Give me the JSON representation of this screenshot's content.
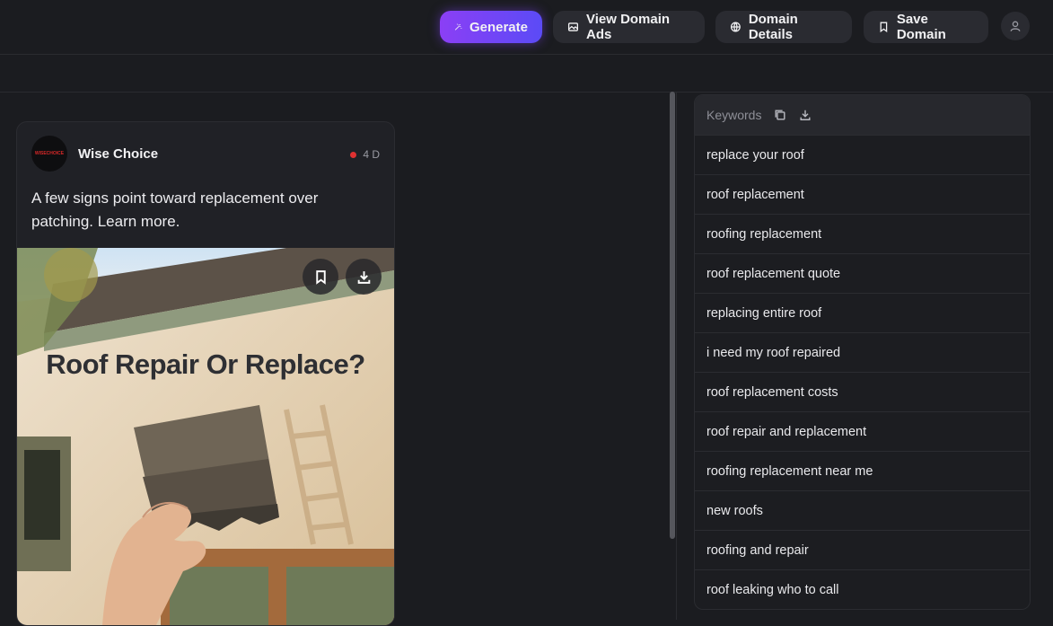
{
  "toolbar": {
    "generate_label": "Generate",
    "view_ads_label": "View Domain Ads",
    "details_label": "Domain Details",
    "save_label": "Save Domain"
  },
  "ad": {
    "brand": "Wise Choice",
    "logo_text": "WISECHOICE",
    "age": "4 D",
    "copy": "A few signs point toward replacement over patching. Learn more.",
    "creative_headline": "Roof Repair Or Replace?"
  },
  "keywords": {
    "header": "Keywords",
    "items": [
      "replace your roof",
      "roof replacement",
      "roofing replacement",
      "roof replacement quote",
      "replacing entire roof",
      "i need my roof repaired",
      "roof replacement costs",
      "roof repair and replacement",
      "roofing replacement near me",
      "new roofs",
      "roofing and repair",
      "roof leaking who to call"
    ]
  },
  "colors": {
    "background": "#1b1c20",
    "accent_start": "#8b3ff5",
    "accent_end": "#5b4bf6",
    "status_dot": "#e03131"
  }
}
